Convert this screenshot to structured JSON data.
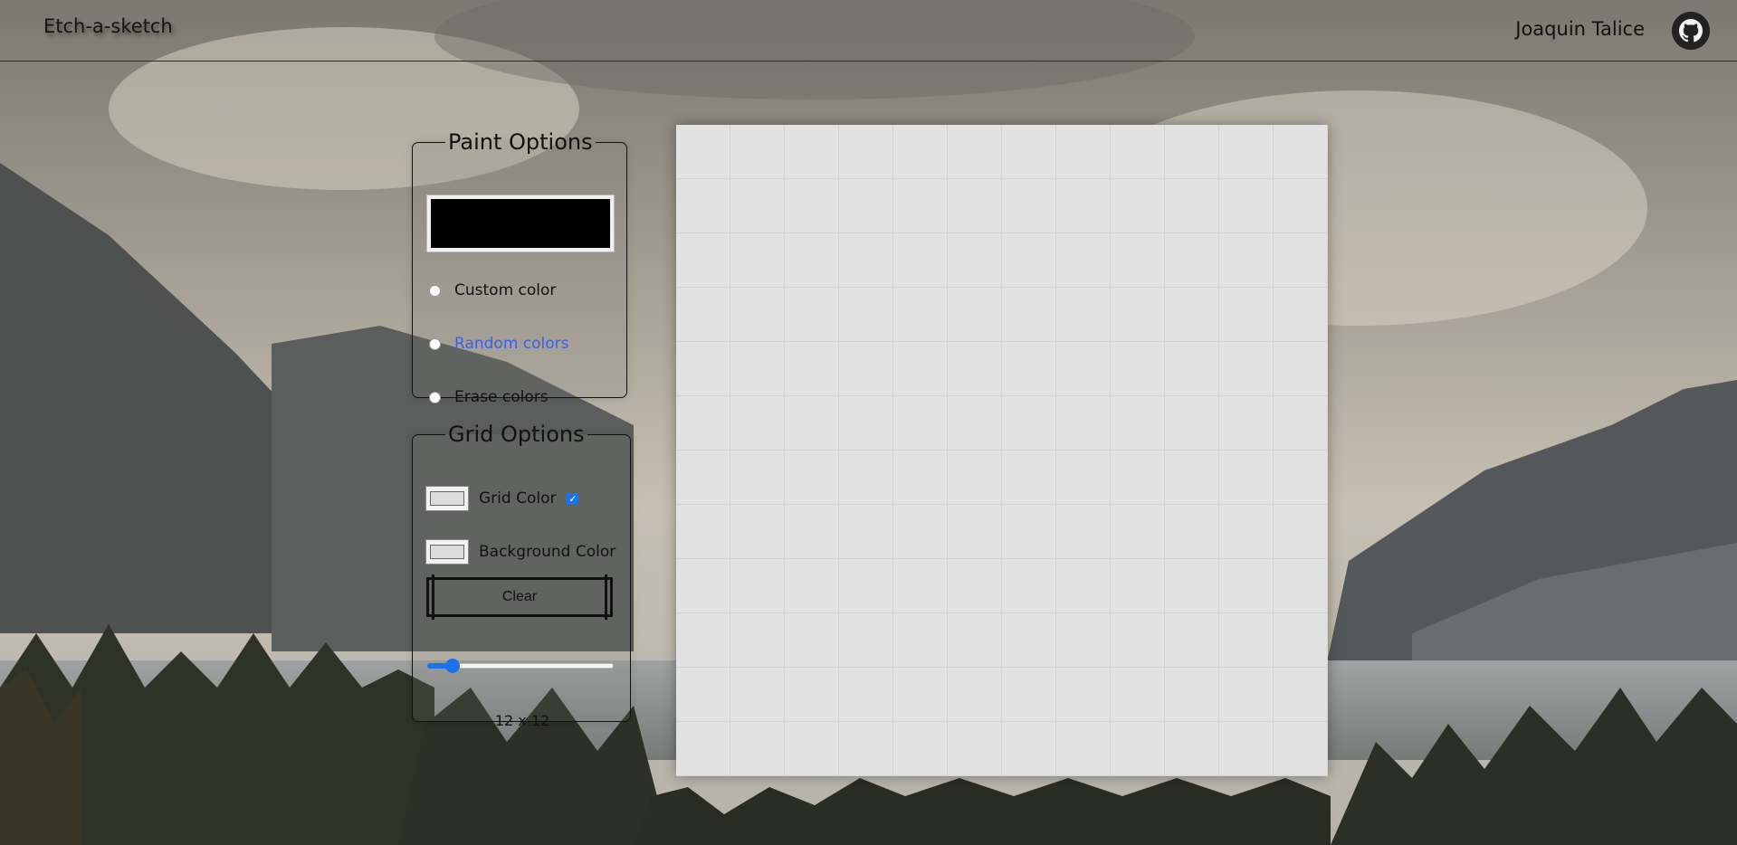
{
  "header": {
    "brand": "Etch-a-sketch",
    "author": "Joaquin Talice",
    "github_icon": "github-icon"
  },
  "paint_options": {
    "legend": "Paint Options",
    "current_color": "#000000",
    "modes": [
      {
        "label": "Custom color",
        "selected": false
      },
      {
        "label": "Random colors",
        "selected": true
      },
      {
        "label": "Erase colors",
        "selected": false
      }
    ]
  },
  "grid_options": {
    "legend": "Grid Options",
    "grid_color_label": "Grid Color",
    "grid_color": "#dcdcdc",
    "grid_color_enabled": true,
    "background_color_label": "Background Color",
    "background_color": "#dcdcdc",
    "clear_label": "Clear",
    "size_label": "12 x 12",
    "grid_size": 12
  },
  "canvas": {
    "rows": 12,
    "cols": 12,
    "background": "#e2e2e2"
  },
  "colors": {
    "accent": "#1a73e8",
    "selected_text": "#3c5ef0"
  }
}
